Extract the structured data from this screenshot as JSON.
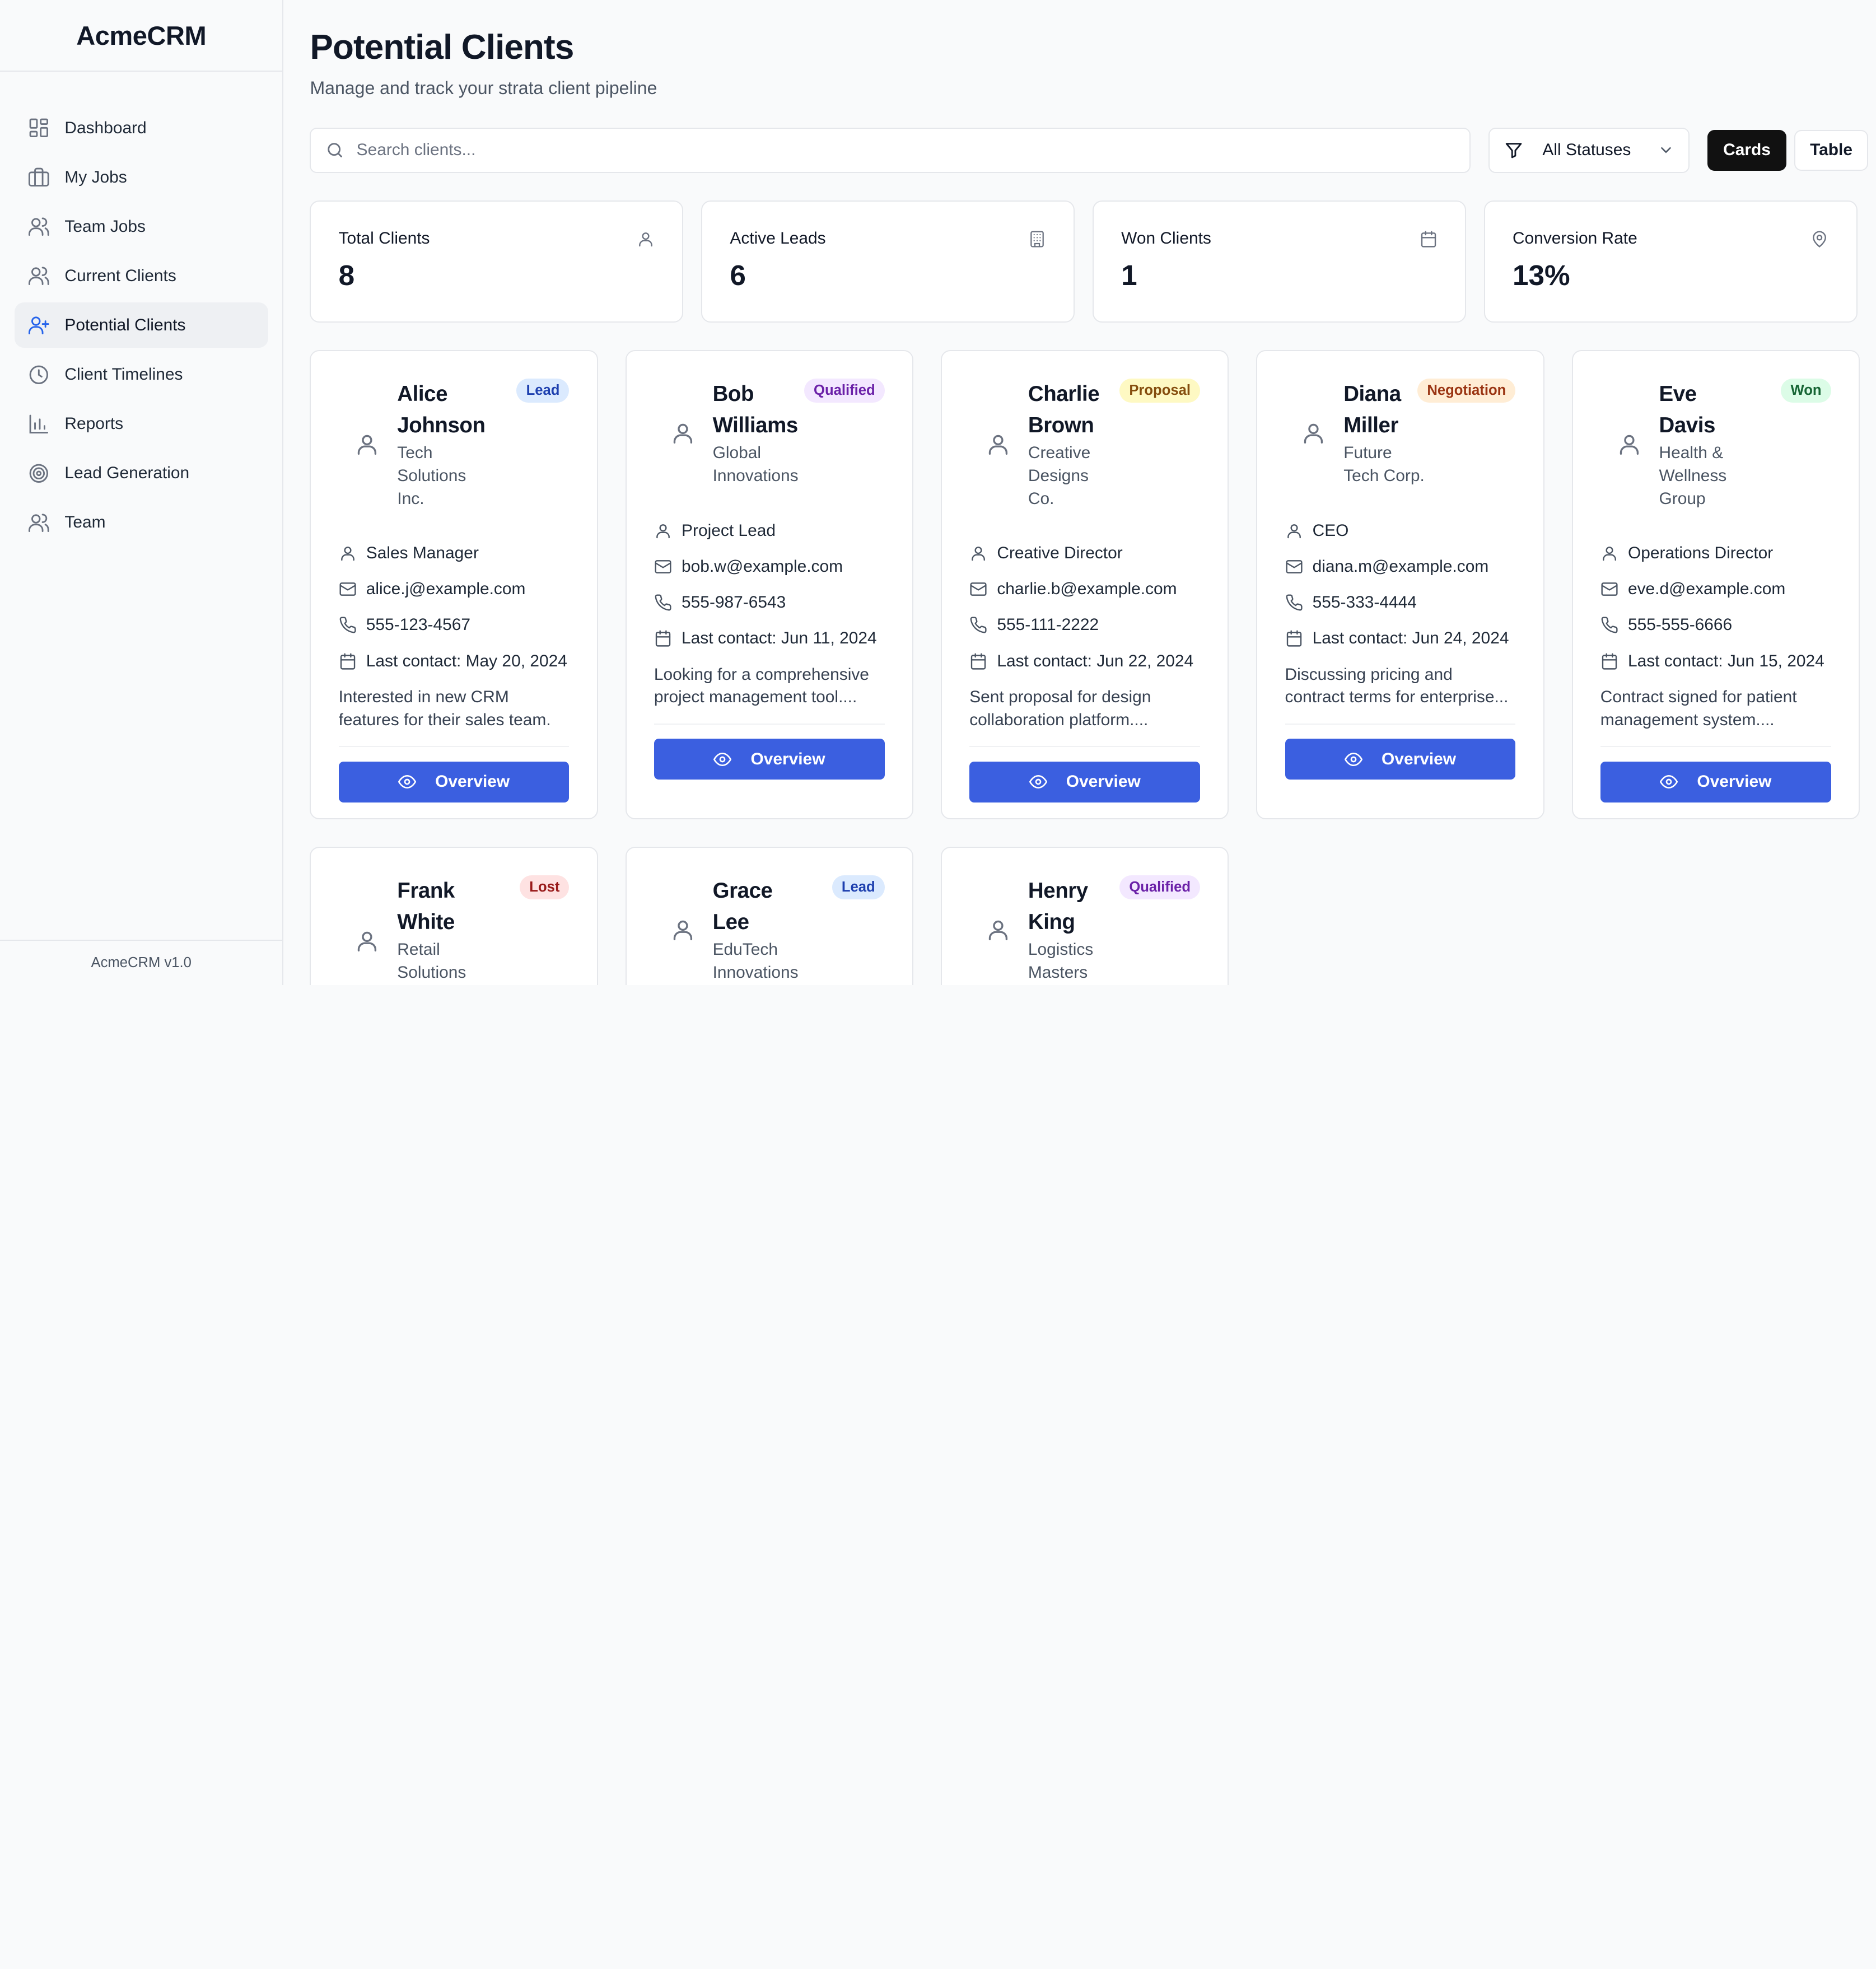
{
  "brand": "AcmeCRM",
  "version": "AcmeCRM v1.0",
  "nav": [
    {
      "label": "Dashboard",
      "icon": "dashboard-icon"
    },
    {
      "label": "My Jobs",
      "icon": "briefcase-icon"
    },
    {
      "label": "Team Jobs",
      "icon": "users-icon"
    },
    {
      "label": "Current Clients",
      "icon": "users-icon"
    },
    {
      "label": "Potential Clients",
      "icon": "user-plus-icon",
      "active": true
    },
    {
      "label": "Client Timelines",
      "icon": "clock-icon"
    },
    {
      "label": "Reports",
      "icon": "bar-chart-icon"
    },
    {
      "label": "Lead Generation",
      "icon": "target-icon"
    },
    {
      "label": "Team",
      "icon": "users-icon"
    }
  ],
  "page": {
    "title": "Potential Clients",
    "subtitle": "Manage and track your strata client pipeline"
  },
  "toolbar": {
    "search_placeholder": "Search clients...",
    "filter_label": "All Statuses",
    "cards_label": "Cards",
    "table_label": "Table"
  },
  "stats": [
    {
      "label": "Total Clients",
      "value": "8",
      "icon": "user-icon"
    },
    {
      "label": "Active Leads",
      "value": "6",
      "icon": "building-icon"
    },
    {
      "label": "Won Clients",
      "value": "1",
      "icon": "calendar-icon"
    },
    {
      "label": "Conversion Rate",
      "value": "13%",
      "icon": "map-pin-icon"
    }
  ],
  "overview_label": "Overview",
  "clients": [
    {
      "name": "Alice Johnson",
      "company": "Tech Solutions Inc.",
      "status": "Lead",
      "role": "Sales Manager",
      "email": "alice.j@example.com",
      "phone": "555-123-4567",
      "last_contact": "Last contact: May 20, 2024",
      "note": "Interested in new CRM features for their sales team."
    },
    {
      "name": "Bob Williams",
      "company": "Global Innovations",
      "status": "Qualified",
      "role": "Project Lead",
      "email": "bob.w@example.com",
      "phone": "555-987-6543",
      "last_contact": "Last contact: Jun 11, 2024",
      "note": "Looking for a comprehensive project management tool...."
    },
    {
      "name": "Charlie Brown",
      "company": "Creative Designs Co.",
      "status": "Proposal",
      "role": "Creative Director",
      "email": "charlie.b@example.com",
      "phone": "555-111-2222",
      "last_contact": "Last contact: Jun 22, 2024",
      "note": "Sent proposal for design collaboration platform...."
    },
    {
      "name": "Diana Miller",
      "company": "Future Tech Corp.",
      "status": "Negotiation",
      "role": "CEO",
      "email": "diana.m@example.com",
      "phone": "555-333-4444",
      "last_contact": "Last contact: Jun 24, 2024",
      "note": "Discussing pricing and contract terms for enterprise..."
    },
    {
      "name": "Eve Davis",
      "company": "Health & Wellness Group",
      "status": "Won",
      "role": "Operations Director",
      "email": "eve.d@example.com",
      "phone": "555-555-6666",
      "last_contact": "Last contact: Jun 15, 2024",
      "note": "Contract signed for patient management system...."
    },
    {
      "name": "Frank White",
      "company": "Retail Solutions Ltd.",
      "status": "Lost"
    },
    {
      "name": "Grace Lee",
      "company": "EduTech Innovations",
      "status": "Lead"
    },
    {
      "name": "Henry King",
      "company": "Logistics Masters",
      "status": "Qualified"
    }
  ]
}
